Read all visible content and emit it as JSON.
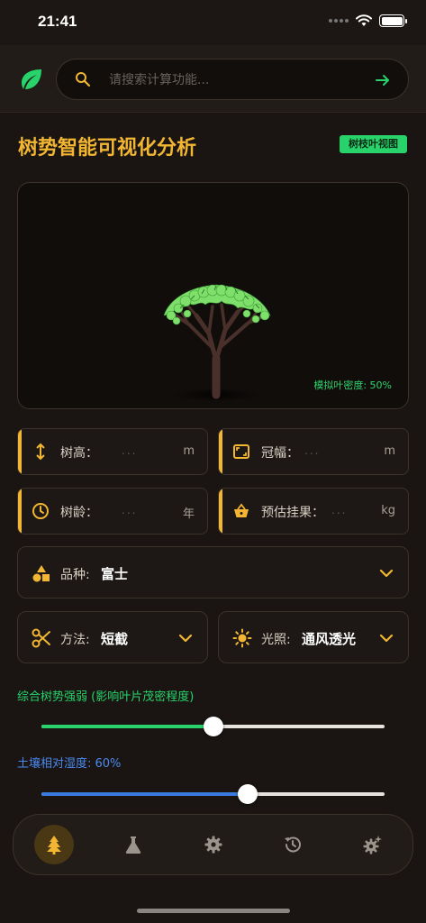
{
  "status": {
    "time": "21:41"
  },
  "search": {
    "placeholder": "请搜索计算功能..."
  },
  "header": {
    "title": "树势智能可视化分析",
    "view_badge": "树枝叶视图"
  },
  "visualization": {
    "density_label": "模拟叶密度: 50%",
    "leaf_density": 0.5
  },
  "fields": {
    "height": {
      "label": "树高：",
      "placeholder": "...",
      "unit": "m",
      "icon": "height-arrows-icon"
    },
    "crown": {
      "label": "冠幅：",
      "placeholder": "...",
      "unit": "m",
      "icon": "crown-frame-icon"
    },
    "age": {
      "label": "树龄：",
      "placeholder": "...",
      "unit": "年",
      "icon": "clock-icon"
    },
    "yield": {
      "label": "预估挂果：",
      "placeholder": "...",
      "unit": "kg",
      "icon": "basket-icon"
    }
  },
  "selects": {
    "variety": {
      "label": "品种:",
      "value": "富士",
      "icon": "shapes-icon"
    },
    "method": {
      "label": "方法:",
      "value": "短截",
      "icon": "scissors-icon"
    },
    "light": {
      "label": "光照:",
      "value": "通风透光",
      "icon": "sun-icon"
    }
  },
  "sliders": {
    "vigor": {
      "label": "综合树势强弱 (影响叶片茂密程度)",
      "value": 0.5,
      "color": "#27d36a"
    },
    "moisture": {
      "label": "土壤相对湿度: 60%",
      "value": 0.6,
      "color": "#3a7be0"
    }
  },
  "nav": {
    "items": [
      {
        "icon": "tree-icon",
        "active": true
      },
      {
        "icon": "flask-icon",
        "active": false
      },
      {
        "icon": "gear-icon",
        "active": false
      },
      {
        "icon": "history-icon",
        "active": false
      },
      {
        "icon": "advanced-settings-icon",
        "active": false
      }
    ]
  },
  "colors": {
    "accent": "#f2b632",
    "green": "#27d36a",
    "blue": "#3a7be0",
    "background": "#1a1512"
  }
}
